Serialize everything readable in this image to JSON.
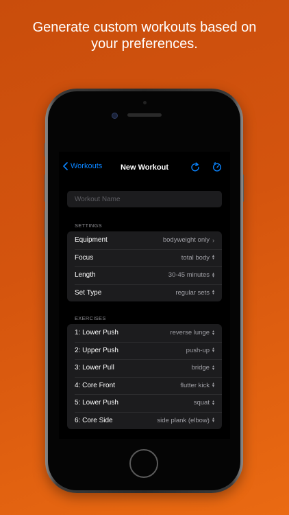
{
  "headline": {
    "line1": "Generate custom workouts based on",
    "line2": "your preferences."
  },
  "nav": {
    "back_label": "Workouts",
    "title": "New Workout",
    "icons": [
      "back-chevron-icon",
      "refresh-icon",
      "timer-icon"
    ],
    "accent_color": "#0a84ff"
  },
  "workout_name": {
    "placeholder": "Workout Name",
    "value": ""
  },
  "settings": {
    "header": "SETTINGS",
    "rows": [
      {
        "label": "Equipment",
        "value": "bodyweight only",
        "indicator": "chevron-right-icon"
      },
      {
        "label": "Focus",
        "value": "total body",
        "indicator": "up-down-icon"
      },
      {
        "label": "Length",
        "value": "30-45 minutes",
        "indicator": "up-down-icon"
      },
      {
        "label": "Set Type",
        "value": "regular sets",
        "indicator": "up-down-icon"
      }
    ]
  },
  "exercises": {
    "header": "EXERCISES",
    "rows": [
      {
        "label": "1: Lower Push",
        "value": "reverse lunge"
      },
      {
        "label": "2: Upper Push",
        "value": "push-up"
      },
      {
        "label": "3: Lower Pull",
        "value": "bridge"
      },
      {
        "label": "4: Core Front",
        "value": "flutter kick"
      },
      {
        "label": "5: Lower Push",
        "value": "squat"
      },
      {
        "label": "6: Core Side",
        "value": "side plank (elbow)"
      }
    ]
  }
}
